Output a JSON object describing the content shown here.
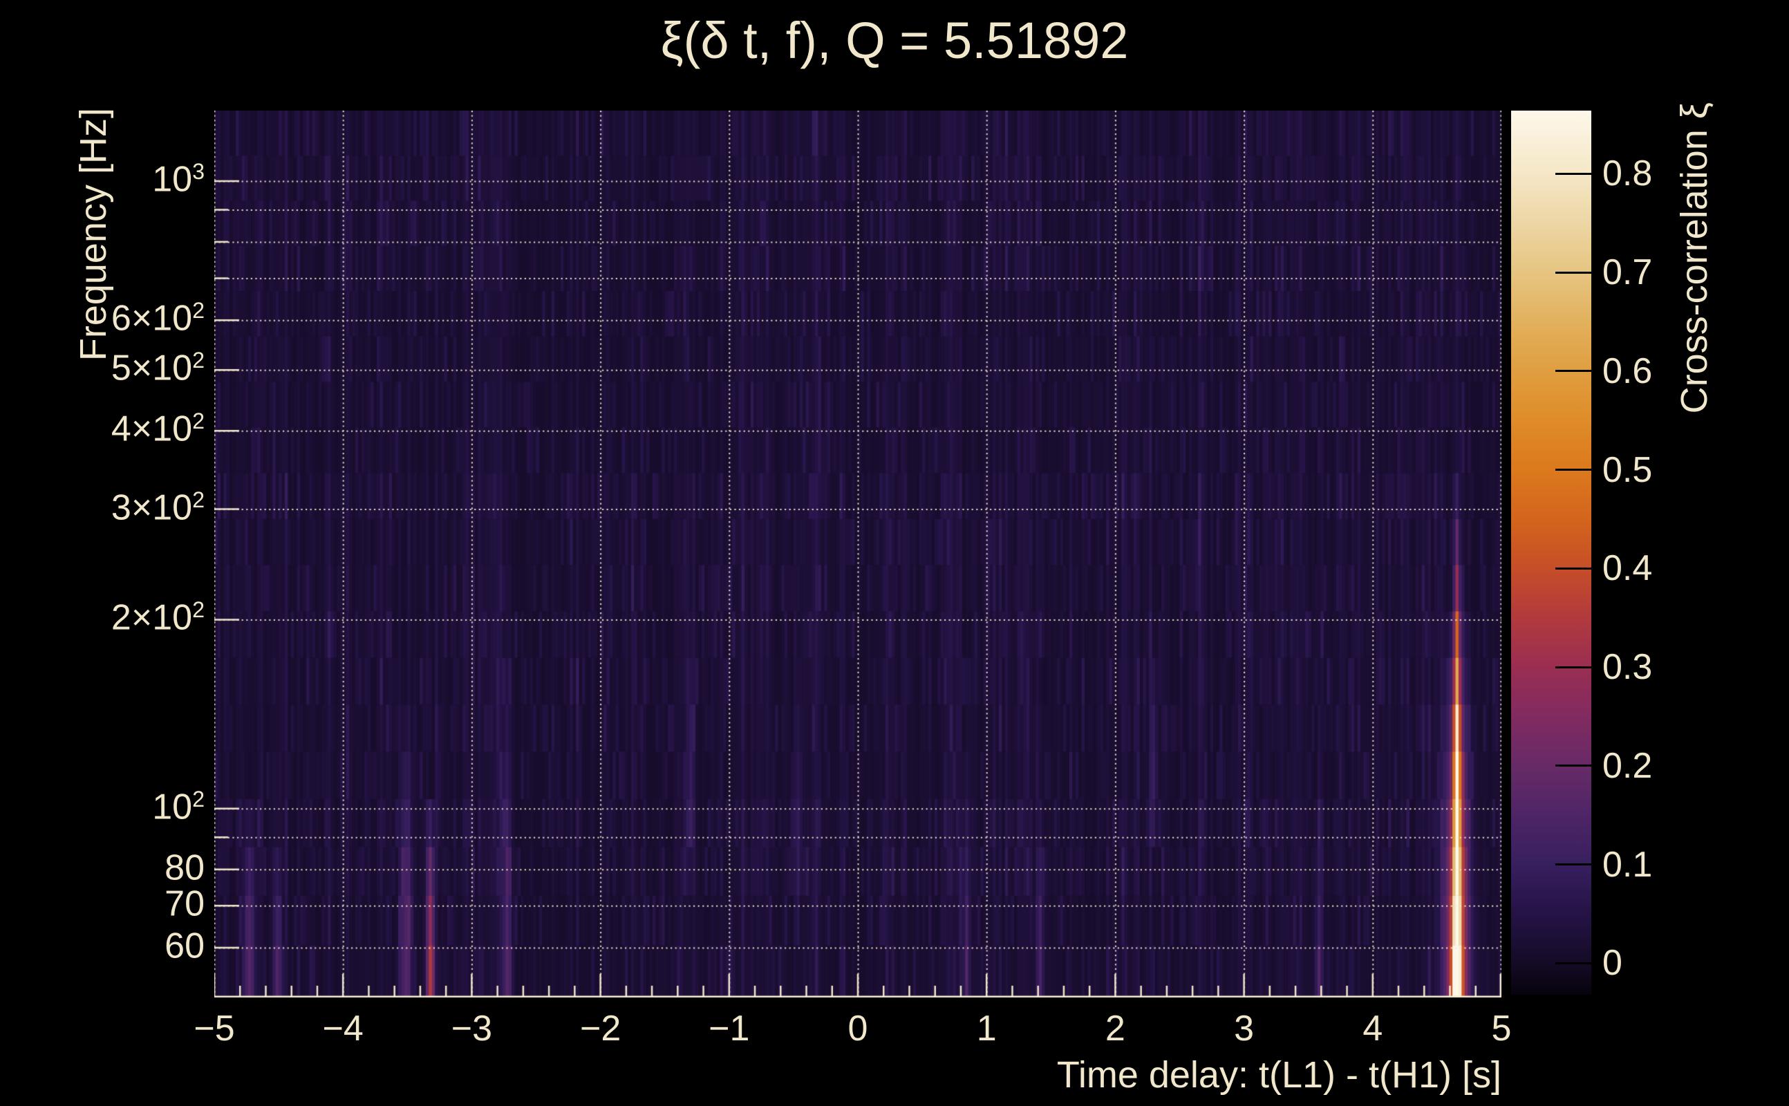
{
  "chart_data": {
    "type": "heatmap",
    "title": "ξ(δ t, f), Q = 5.51892",
    "xlabel": "Time delay: t(L1) - t(H1) [s]",
    "ylabel": "Frequency [Hz]",
    "zlabel": "Cross-correlation ξ",
    "x_range": [
      -5,
      5
    ],
    "y_range": [
      50,
      1295
    ],
    "y_scale": "log",
    "z_range": [
      -0.032,
      0.864
    ],
    "x_ticks": [
      {
        "value": -5,
        "label": "−5"
      },
      {
        "value": -4,
        "label": "−4"
      },
      {
        "value": -3,
        "label": "−3"
      },
      {
        "value": -2,
        "label": "−2"
      },
      {
        "value": -1,
        "label": "−1"
      },
      {
        "value": 0,
        "label": "0"
      },
      {
        "value": 1,
        "label": "1"
      },
      {
        "value": 2,
        "label": "2"
      },
      {
        "value": 3,
        "label": "3"
      },
      {
        "value": 4,
        "label": "4"
      },
      {
        "value": 5,
        "label": "5"
      }
    ],
    "x_minor_step": 0.2,
    "y_ticks": [
      {
        "value": 1000,
        "base": "10",
        "exp": "3"
      },
      {
        "value": 600,
        "base": "6×10",
        "exp": "2"
      },
      {
        "value": 500,
        "base": "5×10",
        "exp": "2"
      },
      {
        "value": 400,
        "base": "4×10",
        "exp": "2"
      },
      {
        "value": 300,
        "base": "3×10",
        "exp": "2"
      },
      {
        "value": 200,
        "base": "2×10",
        "exp": "2"
      },
      {
        "value": 100,
        "base": "10",
        "exp": "2"
      },
      {
        "value": 80,
        "base": "80",
        "exp": ""
      },
      {
        "value": 70,
        "base": "70",
        "exp": ""
      },
      {
        "value": 60,
        "base": "60",
        "exp": ""
      }
    ],
    "y_grid_values": [
      60,
      70,
      80,
      90,
      100,
      200,
      300,
      400,
      500,
      600,
      700,
      800,
      900,
      1000
    ],
    "x_grid_values": [
      -5,
      -4,
      -3,
      -2,
      -1,
      0,
      1,
      2,
      3,
      4,
      5
    ],
    "z_ticks": [
      {
        "value": 0,
        "label": "0"
      },
      {
        "value": 0.1,
        "label": "0.1"
      },
      {
        "value": 0.2,
        "label": "0.2"
      },
      {
        "value": 0.3,
        "label": "0.3"
      },
      {
        "value": 0.4,
        "label": "0.4"
      },
      {
        "value": 0.5,
        "label": "0.5"
      },
      {
        "value": 0.6,
        "label": "0.6"
      },
      {
        "value": 0.7,
        "label": "0.7"
      },
      {
        "value": 0.8,
        "label": "0.8"
      }
    ],
    "palette": [
      {
        "v": -0.032,
        "c": "#07030d"
      },
      {
        "v": 0.0,
        "c": "#150b26"
      },
      {
        "v": 0.05,
        "c": "#241345"
      },
      {
        "v": 0.1,
        "c": "#371f5e"
      },
      {
        "v": 0.15,
        "c": "#4e2566"
      },
      {
        "v": 0.2,
        "c": "#672a67"
      },
      {
        "v": 0.25,
        "c": "#812b60"
      },
      {
        "v": 0.3,
        "c": "#9a2e52"
      },
      {
        "v": 0.35,
        "c": "#b13a3d"
      },
      {
        "v": 0.4,
        "c": "#c64e28"
      },
      {
        "v": 0.45,
        "c": "#d3651d"
      },
      {
        "v": 0.5,
        "c": "#dc791d"
      },
      {
        "v": 0.55,
        "c": "#df8c2a"
      },
      {
        "v": 0.6,
        "c": "#e09e40"
      },
      {
        "v": 0.65,
        "c": "#e2b15d"
      },
      {
        "v": 0.7,
        "c": "#e6c581"
      },
      {
        "v": 0.75,
        "c": "#edd6a4"
      },
      {
        "v": 0.8,
        "c": "#f5e7c6"
      },
      {
        "v": 0.864,
        "c": "#fdf8ea"
      }
    ],
    "colors": {
      "background": "#000000",
      "text": "#f1e7cb",
      "grid": "#f3e9d0",
      "axis": "#f1e7cb",
      "colorbar_tick": "#000000"
    },
    "grid": true,
    "features": [
      {
        "name": "primary-peak",
        "t": 4.655,
        "sigma_s": 0.016,
        "xi_peak": 0.87,
        "f_ref": 55,
        "f_span_decades": 0.78,
        "halo": {
          "sigma_s": 0.09,
          "xi": 0.1
        }
      },
      {
        "name": "primary-peak-wings",
        "t": 4.655,
        "sigma_s": 0.05,
        "xi_peak": 0.46,
        "f_ref": 55,
        "f_span_decades": 0.62
      },
      {
        "name": "secondary-peak",
        "t": -3.321,
        "sigma_s": 0.02,
        "xi_peak": 0.33,
        "f_ref": 55,
        "f_span_decades": 0.3
      },
      {
        "name": "minor-column-a",
        "t": -3.512,
        "sigma_s": 0.03,
        "xi_peak": 0.15,
        "f_ref": 55,
        "f_span_decades": 0.45
      },
      {
        "name": "minor-column-b",
        "t": -2.726,
        "sigma_s": 0.025,
        "xi_peak": 0.13,
        "f_ref": 55,
        "f_span_decades": 0.5
      },
      {
        "name": "minor-column-c",
        "t": -4.726,
        "sigma_s": 0.03,
        "xi_peak": 0.15,
        "f_ref": 55,
        "f_span_decades": 0.3
      },
      {
        "name": "minor-column-d",
        "t": 2.298,
        "sigma_s": 0.02,
        "xi_peak": 0.17,
        "f_ref": 55,
        "f_span_decades": 0.55,
        "f_lo": 108
      },
      {
        "name": "minor-column-e",
        "t": -1.298,
        "sigma_s": 0.02,
        "xi_peak": 0.12,
        "f_ref": 55,
        "f_span_decades": 0.6,
        "f_lo": 95
      },
      {
        "name": "minor-column-f",
        "t": 0.845,
        "sigma_s": 0.02,
        "xi_peak": 0.11,
        "f_ref": 55,
        "f_span_decades": 0.4
      },
      {
        "name": "minor-column-g",
        "t": -4.512,
        "sigma_s": 0.022,
        "xi_peak": 0.12,
        "f_ref": 55,
        "f_span_decades": 0.25
      },
      {
        "name": "minor-column-h",
        "t": 3.583,
        "sigma_s": 0.02,
        "xi_peak": 0.1,
        "f_ref": 55,
        "f_span_decades": 0.3
      },
      {
        "name": "minor-column-i",
        "t": -0.464,
        "sigma_s": 0.02,
        "xi_peak": 0.1,
        "f_ref": 55,
        "f_span_decades": 0.5,
        "f_lo": 90
      },
      {
        "name": "minor-column-j",
        "t": 1.417,
        "sigma_s": 0.02,
        "xi_peak": 0.11,
        "f_ref": 55,
        "f_span_decades": 0.3
      }
    ],
    "noise": {
      "seed": 1337,
      "n_time_bins": 420,
      "n_freq_bins": 19,
      "freq_skew": 0.96,
      "base_level": 0.012,
      "column_gain": 0.052,
      "speckle_gain": 0.045,
      "band_boost_low_hz": 100,
      "band_boost_range_hz": [
        120,
        340
      ]
    }
  }
}
